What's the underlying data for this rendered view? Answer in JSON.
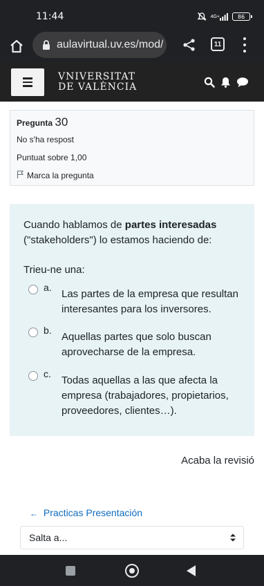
{
  "status_bar": {
    "time": "11:44",
    "network_label": "4G+",
    "battery": "86",
    "icons": [
      "mute-icon",
      "signal-icon",
      "battery-icon"
    ]
  },
  "browser": {
    "url": "aulavirtual.uv.es/mod/",
    "tab_count": "11",
    "icons": [
      "home-icon",
      "lock-icon",
      "share-icon",
      "tabs-icon",
      "overflow-menu-icon"
    ]
  },
  "site_header": {
    "logo_line1": "VNIVERSITAT",
    "logo_line2": "DE VALÈNCIA",
    "icons": [
      "hamburger-icon",
      "search-icon",
      "bell-icon",
      "chat-icon"
    ]
  },
  "question_info": {
    "label": "Pregunta",
    "number": "30",
    "state": "No s'ha respost",
    "grade": "Puntuat sobre 1,00",
    "flag_label": "Marca la pregunta"
  },
  "question": {
    "prompt_before": "Cuando hablamos de ",
    "prompt_bold": "partes interesadas",
    "prompt_after": " (\"stakeholders\") lo estamos haciendo de:",
    "choose_label": "Trieu-ne una:",
    "answers": [
      {
        "letter": "a.",
        "text": "Las partes de la empresa que resultan interesantes para los inversores."
      },
      {
        "letter": "b.",
        "text": "Aquellas partes que solo buscan aprovecharse de la empresa."
      },
      {
        "letter": "c.",
        "text": "Todas aquellas a las que afecta la empresa (trabajadores, propietarios, proveedores, clientes…)."
      }
    ]
  },
  "finish_review": "Acaba la revisió",
  "navigation": {
    "prev_arrow": "←",
    "prev_link": "Practicas Presentación",
    "jump_select": "Salta a..."
  },
  "colors": {
    "header_bg": "#222222",
    "question_bg": "#e7f3f5",
    "info_bg": "#f8f9fa",
    "link": "#0f6cbf"
  }
}
